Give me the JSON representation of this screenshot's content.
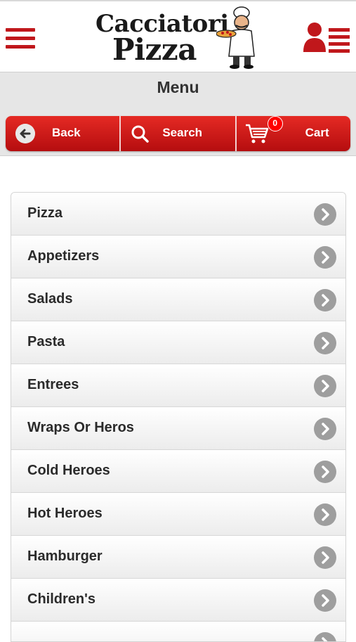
{
  "header": {
    "brand_line1": "Cacciatori",
    "brand_line2": "Pizza"
  },
  "titlebar": {
    "title": "Menu"
  },
  "nav": {
    "back_label": "Back",
    "search_label": "Search",
    "cart_label": "Cart",
    "cart_count": "0"
  },
  "menu": {
    "items": [
      {
        "label": "Pizza"
      },
      {
        "label": "Appetizers"
      },
      {
        "label": "Salads"
      },
      {
        "label": "Pasta"
      },
      {
        "label": "Entrees"
      },
      {
        "label": "Wraps Or Heros"
      },
      {
        "label": "Cold Heroes"
      },
      {
        "label": "Hot Heroes"
      },
      {
        "label": "Hamburger"
      },
      {
        "label": "Children's"
      },
      {
        "label": ""
      }
    ]
  },
  "colors": {
    "brand_red": "#c0171b",
    "nav_gradient_top": "#e52a24",
    "nav_gradient_bottom": "#b50d0f",
    "chevron_grey": "#9e9e9e"
  },
  "icons": [
    "hamburger-menu-icon",
    "chef-mascot-icon",
    "user-list-icon",
    "back-arrow-icon",
    "search-icon",
    "cart-icon",
    "chevron-right-icon"
  ]
}
